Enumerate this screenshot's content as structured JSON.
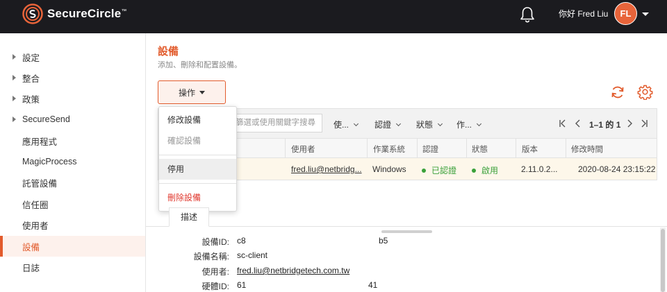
{
  "header": {
    "brand": "SecureCircle",
    "brand_tm": "™",
    "greeting": "你好 Fred Liu",
    "avatar_initials": "FL",
    "accent_color": "#e25b2c"
  },
  "sidebar": {
    "items": [
      {
        "label": "設定",
        "expandable": true
      },
      {
        "label": "整合",
        "expandable": true
      },
      {
        "label": "政策",
        "expandable": true
      },
      {
        "label": "SecureSend",
        "expandable": true
      },
      {
        "label": "應用程式",
        "expandable": false
      },
      {
        "label": "MagicProcess",
        "expandable": false
      },
      {
        "label": "託管設備",
        "expandable": false
      },
      {
        "label": "信任圈",
        "expandable": false
      },
      {
        "label": "使用者",
        "expandable": false
      },
      {
        "label": "設備",
        "expandable": false,
        "active": true
      },
      {
        "label": "日誌",
        "expandable": false
      }
    ]
  },
  "page": {
    "title": "設備",
    "subtitle": "添加、刪除和配置設備。",
    "action_label": "操作"
  },
  "toolbar": {
    "search_placeholder": "篩選或使用關鍵字搜尋",
    "filters": [
      "使...",
      "認證",
      "狀態",
      "作..."
    ],
    "pager_text": "1–1 的 1"
  },
  "table": {
    "headers": [
      "使用者",
      "作業系統",
      "認證",
      "狀態",
      "版本",
      "修改時間"
    ],
    "rows": [
      {
        "user": "fred.liu@netbridg...",
        "os": "Windows",
        "auth": "已認證",
        "status": "啟用",
        "version": "2.11.0.2...",
        "modified": "2020-08-24 23:15:22"
      }
    ]
  },
  "menu": {
    "items": [
      {
        "label": "修改設備",
        "state": "normal"
      },
      {
        "label": "確認設備",
        "state": "disabled"
      },
      {
        "label": "停用",
        "state": "hover"
      },
      {
        "label": "刪除設備",
        "state": "danger"
      }
    ]
  },
  "detail": {
    "tab": "描述",
    "rows": [
      {
        "label": "設備ID:",
        "value": "c8",
        "value2": "b5"
      },
      {
        "label": "設備名稱:",
        "value": "sc-client"
      },
      {
        "label": "使用者:",
        "value": "fred.liu@netbridgetech.com.tw"
      },
      {
        "label": "硬體ID:",
        "value": "61",
        "value2": "41"
      }
    ]
  }
}
